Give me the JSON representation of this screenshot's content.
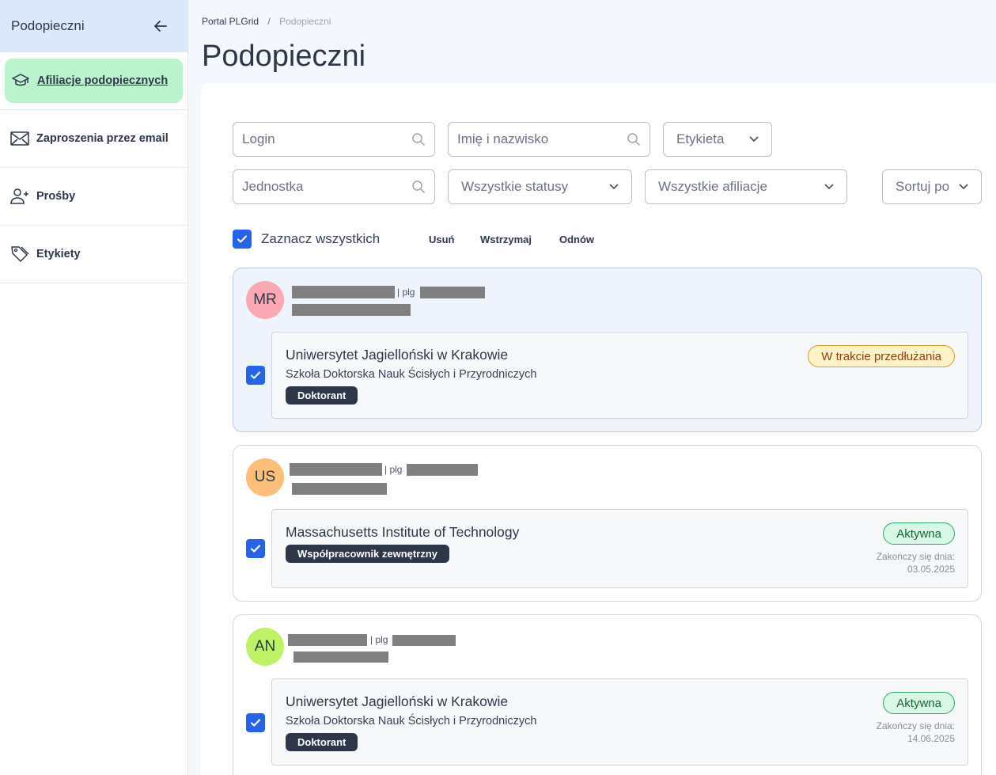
{
  "sidebar": {
    "title": "Podopieczni",
    "items": [
      {
        "label": "Afiliacje podopiecznych",
        "icon": "graduation-cap-icon",
        "active": true
      },
      {
        "label": "Zaproszenia przez email",
        "icon": "envelope-icon"
      },
      {
        "label": "Prośby",
        "icon": "user-plus-icon"
      },
      {
        "label": "Etykiety",
        "icon": "tags-icon"
      }
    ]
  },
  "breadcrumb": {
    "root": "Portal PLGrid",
    "separator": "/",
    "current": "Podopieczni"
  },
  "page": {
    "title": "Podopieczni"
  },
  "filters": {
    "login_placeholder": "Login",
    "name_placeholder": "Imię i nazwisko",
    "label_select": "Etykieta",
    "unit_placeholder": "Jednostka",
    "status_select": "Wszystkie statusy",
    "affiliation_select": "Wszystkie afiliacje",
    "sort_select": "Sortuj po"
  },
  "bulk": {
    "select_all": "Zaznacz wszystkich",
    "delete": "Usuń",
    "suspend": "Wstrzymaj",
    "renew": "Odnów"
  },
  "cards": [
    {
      "initials": "MR",
      "avatar_color": "#f9a8b4",
      "plg_prefix": "| plg",
      "affiliations": [
        {
          "institution": "Uniwersytet Jagielloński w Krakowie",
          "unit": "Szkoła Doktorska Nauk Ścisłych i Przyrodniczych",
          "role": "Doktorant",
          "status": "W trakcie przedłużania"
        }
      ]
    },
    {
      "initials": "US",
      "avatar_color": "#fbbf7a",
      "plg_prefix": "| plg",
      "affiliations": [
        {
          "institution": "Massachusetts Institute of Technology",
          "role": "Współpracownik zewnętrzny",
          "status": "Aktywna",
          "end_label": "Zakończy się dnia:",
          "end_date": "03.05.2025"
        }
      ]
    },
    {
      "initials": "AN",
      "avatar_color": "#bef264",
      "plg_prefix": "| plg",
      "affiliations": [
        {
          "institution": "Uniwersytet Jagielloński w Krakowie",
          "unit": "Szkoła Doktorska Nauk Ścisłych i Przyrodniczych",
          "role": "Doktorant",
          "status": "Aktywna",
          "end_label": "Zakończy się dnia:",
          "end_date": "14.06.2025"
        }
      ]
    }
  ]
}
